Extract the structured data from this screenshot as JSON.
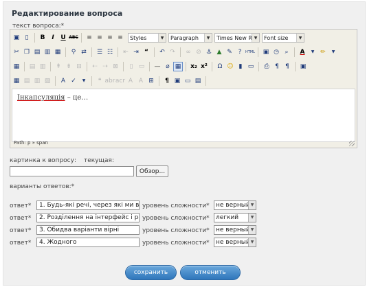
{
  "form": {
    "title": "Редактирование вопроса",
    "question_label": "текст вопроса:*"
  },
  "editor": {
    "styles_select": "Styles",
    "format_select": "Paragraph",
    "font_select": "Times New Roman",
    "size_select": "Font size",
    "content_word": "Інкапсуляція",
    "content_rest": " – це…",
    "path": "Path: p » span"
  },
  "image": {
    "label": "картинка к вопросу:",
    "current_label": "текущая:",
    "browse_button": "Обзор..."
  },
  "answers": {
    "label": "варианты ответов:*",
    "answer_label": "ответ*",
    "level_label": "уровень сложности*",
    "rows": [
      {
        "text": "1. Будь-які речі, через які ми вз",
        "level": "не верный"
      },
      {
        "text": "2. Розділення на інтерфейс і реа",
        "level": "легкий"
      },
      {
        "text": "3. Обидва варіанти вірні",
        "level": "не верный"
      },
      {
        "text": "4. Жодного",
        "level": "не верный"
      }
    ]
  },
  "buttons": {
    "save": "сохранить",
    "cancel": "отменить"
  },
  "colors": {
    "panel_bg": "#f0f0f0",
    "button_blue": "#2f76bb",
    "editor_toolbar_bg": "#f1efe6"
  }
}
